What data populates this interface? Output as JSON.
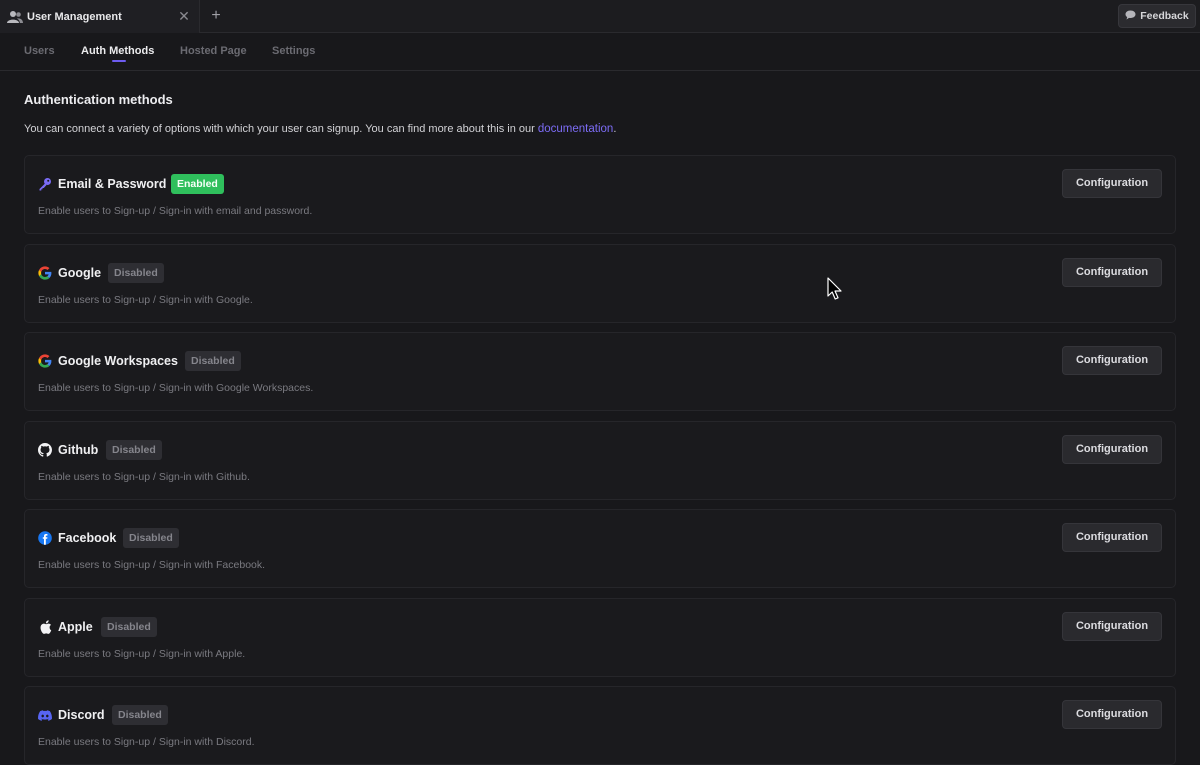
{
  "window": {
    "tab_title": "User Management",
    "feedback_label": "Feedback"
  },
  "nav": {
    "tabs": [
      {
        "label": "Users",
        "active": false
      },
      {
        "label": "Auth Methods",
        "active": true
      },
      {
        "label": "Hosted Page",
        "active": false
      },
      {
        "label": "Settings",
        "active": false
      }
    ]
  },
  "page": {
    "title": "Authentication methods",
    "description": "You can connect a variety of options with which your user can signup. You can find more about this in our",
    "doc_link": "documentation",
    "doc_suffix": "."
  },
  "methods": [
    {
      "name": "Email & Password",
      "status": "Enabled",
      "description": "Enable users to Sign-up / Sign-in with email and password.",
      "button": "Configuration",
      "icon": "key-icon"
    },
    {
      "name": "Google",
      "status": "Disabled",
      "description": "Enable users to Sign-up / Sign-in with Google.",
      "button": "Configuration",
      "icon": "google-icon"
    },
    {
      "name": "Google Workspaces",
      "status": "Disabled",
      "description": "Enable users to Sign-up / Sign-in with Google Workspaces.",
      "button": "Configuration",
      "icon": "google-icon"
    },
    {
      "name": "Github",
      "status": "Disabled",
      "description": "Enable users to Sign-up / Sign-in with Github.",
      "button": "Configuration",
      "icon": "github-icon"
    },
    {
      "name": "Facebook",
      "status": "Disabled",
      "description": "Enable users to Sign-up / Sign-in with Facebook.",
      "button": "Configuration",
      "icon": "facebook-icon"
    },
    {
      "name": "Apple",
      "status": "Disabled",
      "description": "Enable users to Sign-up / Sign-in with Apple.",
      "button": "Configuration",
      "icon": "apple-icon"
    },
    {
      "name": "Discord",
      "status": "Disabled",
      "description": "Enable users to Sign-up / Sign-in with Discord.",
      "button": "Configuration",
      "icon": "discord-icon"
    }
  ],
  "colors": {
    "accent": "#6d5cf0",
    "enabled": "#2fbf5c",
    "background": "#18181b"
  }
}
